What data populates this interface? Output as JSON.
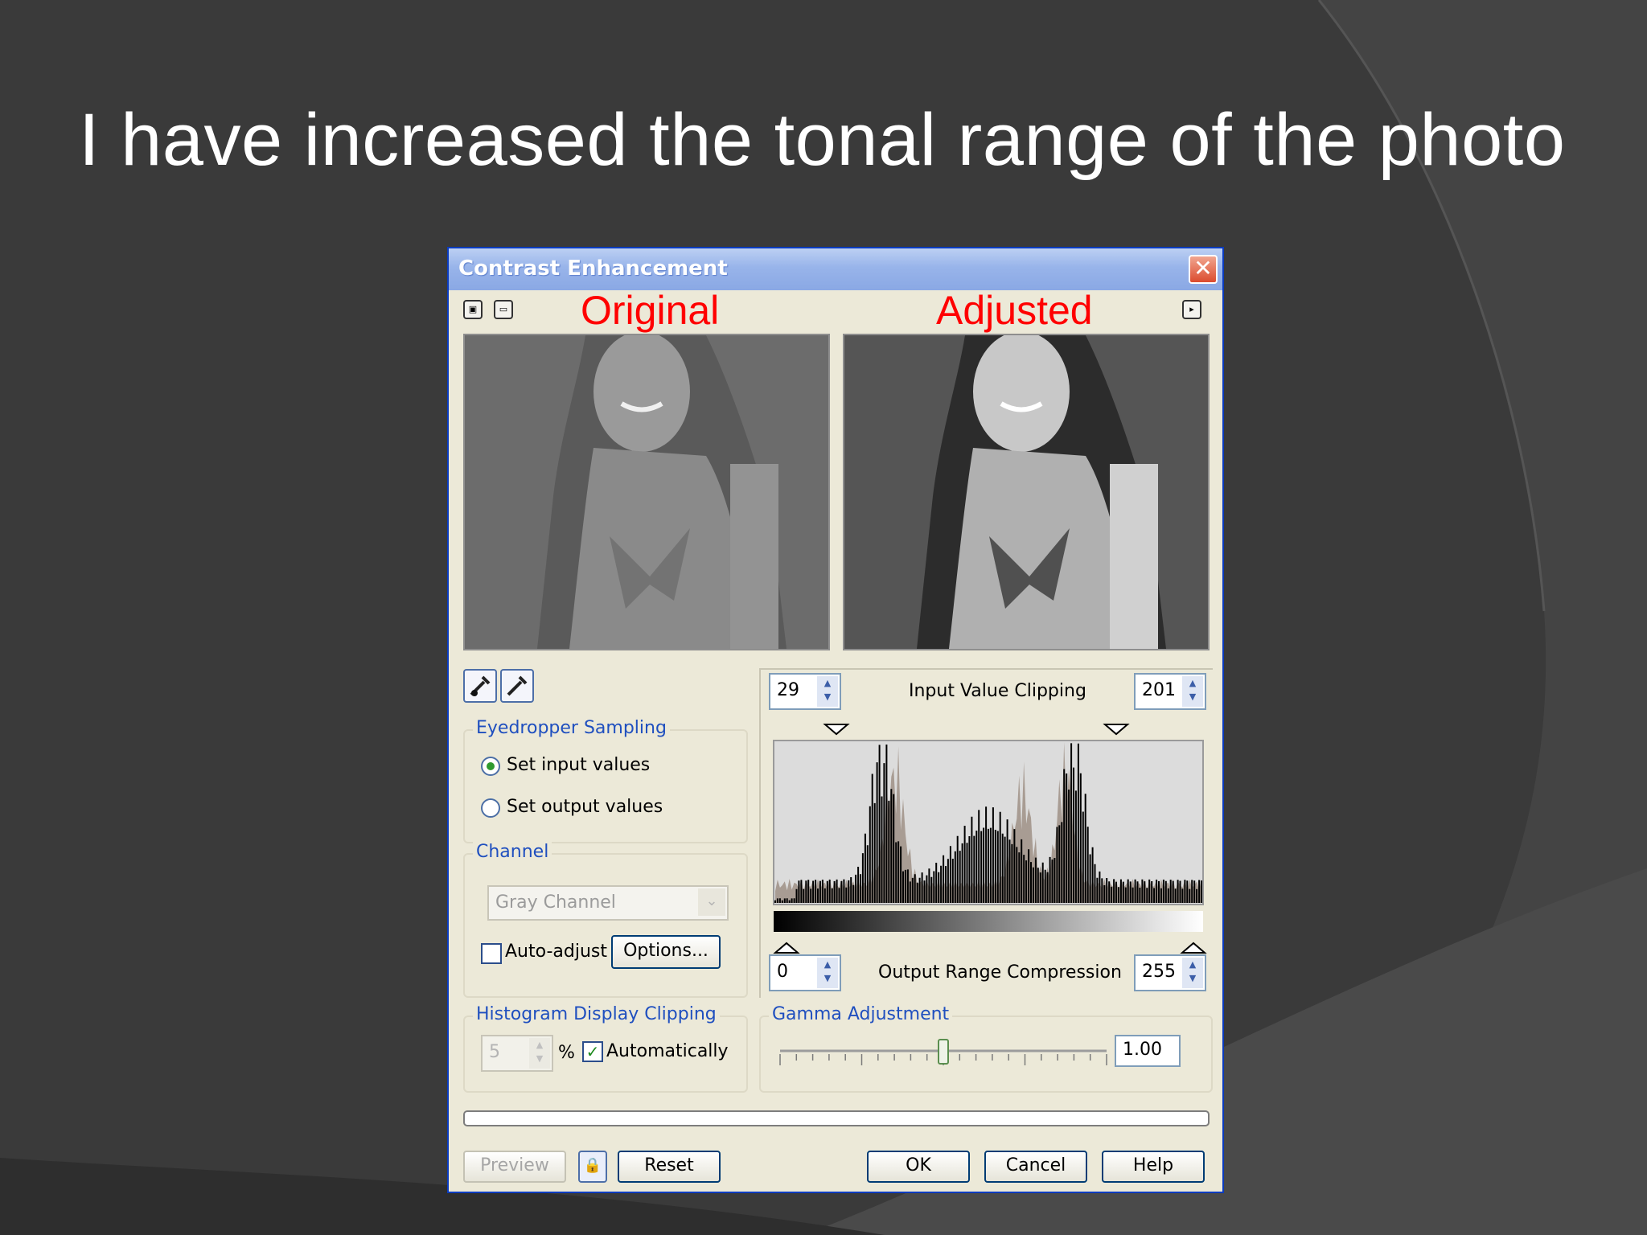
{
  "slide": {
    "title": "I have increased the tonal range of the photo"
  },
  "dialog": {
    "title": "Contrast Enhancement",
    "close_glyph": "✕",
    "icons": [
      "split-view-icon",
      "single-view-icon",
      "play-preview-icon",
      "eyedropper-icon",
      "eyedropper-set-icon",
      "lock-icon"
    ],
    "labels": {
      "original": "Original",
      "adjusted": "Adjusted"
    },
    "eyedropper_sampling": {
      "title": "Eyedropper Sampling",
      "options": [
        "Set input values",
        "Set output values"
      ],
      "selected": "Set input values"
    },
    "channel": {
      "title": "Channel",
      "value": "Gray Channel",
      "auto_adjust_label": "Auto-adjust",
      "auto_adjust_checked": false,
      "options_button": "Options..."
    },
    "input_clipping": {
      "label": "Input Value Clipping",
      "low": "29",
      "high": "201"
    },
    "output_range": {
      "label": "Output Range Compression",
      "low": "0",
      "high": "255"
    },
    "histogram_display_clipping": {
      "title": "Histogram Display Clipping",
      "value": "5",
      "unit": "%",
      "auto_label": "Automatically",
      "auto_checked": true
    },
    "gamma": {
      "title": "Gamma Adjustment",
      "value": "1.00",
      "slider_fraction": 0.5
    },
    "buttons": {
      "preview": "Preview",
      "reset": "Reset",
      "ok": "OK",
      "cancel": "Cancel",
      "help": "Help"
    }
  }
}
